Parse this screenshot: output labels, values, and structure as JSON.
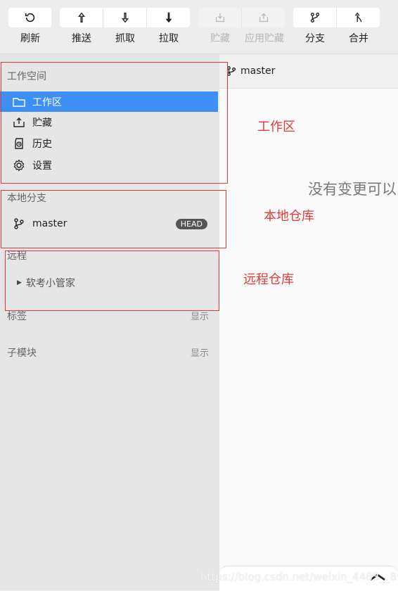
{
  "toolbar": {
    "refresh": "刷新",
    "push": "推送",
    "fetch": "抓取",
    "pull": "拉取",
    "stash": "贮藏",
    "apply_stash": "应用贮藏",
    "branch": "分支",
    "merge": "合并"
  },
  "sidebar": {
    "workspace_title": "工作空间",
    "items": [
      {
        "label": "工作区",
        "icon": "folder-icon"
      },
      {
        "label": "贮藏",
        "icon": "stash-icon"
      },
      {
        "label": "历史",
        "icon": "history-icon"
      },
      {
        "label": "设置",
        "icon": "gear-icon"
      }
    ],
    "local_branches_title": "本地分支",
    "branch": {
      "name": "master",
      "badge": "HEAD"
    },
    "remotes_title": "远程",
    "remote_name": "软考小管家",
    "tags_title": "标签",
    "tags_show": "显示",
    "submodules_title": "子模块",
    "submodules_show": "显示"
  },
  "main": {
    "branch": "master",
    "empty_message": "没有变更可以"
  },
  "annotations": {
    "workspace": "工作区",
    "local_repo": "本地仓库",
    "remote_repo": "远程仓库"
  },
  "watermark": "https://blog.csdn.net/weixin_4483__89",
  "colors": {
    "accent": "#3d8ff5",
    "annotation": "#e23a3a",
    "badge": "#555555"
  }
}
